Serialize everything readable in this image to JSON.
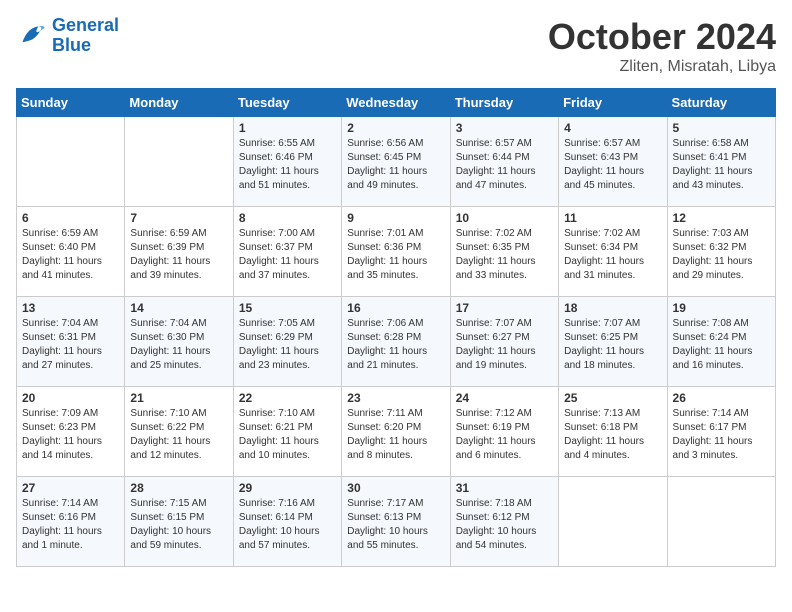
{
  "logo": {
    "line1": "General",
    "line2": "Blue"
  },
  "title": "October 2024",
  "subtitle": "Zliten, Misratah, Libya",
  "weekdays": [
    "Sunday",
    "Monday",
    "Tuesday",
    "Wednesday",
    "Thursday",
    "Friday",
    "Saturday"
  ],
  "weeks": [
    [
      {
        "day": "",
        "info": ""
      },
      {
        "day": "",
        "info": ""
      },
      {
        "day": "1",
        "info": "Sunrise: 6:55 AM\nSunset: 6:46 PM\nDaylight: 11 hours and 51 minutes."
      },
      {
        "day": "2",
        "info": "Sunrise: 6:56 AM\nSunset: 6:45 PM\nDaylight: 11 hours and 49 minutes."
      },
      {
        "day": "3",
        "info": "Sunrise: 6:57 AM\nSunset: 6:44 PM\nDaylight: 11 hours and 47 minutes."
      },
      {
        "day": "4",
        "info": "Sunrise: 6:57 AM\nSunset: 6:43 PM\nDaylight: 11 hours and 45 minutes."
      },
      {
        "day": "5",
        "info": "Sunrise: 6:58 AM\nSunset: 6:41 PM\nDaylight: 11 hours and 43 minutes."
      }
    ],
    [
      {
        "day": "6",
        "info": "Sunrise: 6:59 AM\nSunset: 6:40 PM\nDaylight: 11 hours and 41 minutes."
      },
      {
        "day": "7",
        "info": "Sunrise: 6:59 AM\nSunset: 6:39 PM\nDaylight: 11 hours and 39 minutes."
      },
      {
        "day": "8",
        "info": "Sunrise: 7:00 AM\nSunset: 6:37 PM\nDaylight: 11 hours and 37 minutes."
      },
      {
        "day": "9",
        "info": "Sunrise: 7:01 AM\nSunset: 6:36 PM\nDaylight: 11 hours and 35 minutes."
      },
      {
        "day": "10",
        "info": "Sunrise: 7:02 AM\nSunset: 6:35 PM\nDaylight: 11 hours and 33 minutes."
      },
      {
        "day": "11",
        "info": "Sunrise: 7:02 AM\nSunset: 6:34 PM\nDaylight: 11 hours and 31 minutes."
      },
      {
        "day": "12",
        "info": "Sunrise: 7:03 AM\nSunset: 6:32 PM\nDaylight: 11 hours and 29 minutes."
      }
    ],
    [
      {
        "day": "13",
        "info": "Sunrise: 7:04 AM\nSunset: 6:31 PM\nDaylight: 11 hours and 27 minutes."
      },
      {
        "day": "14",
        "info": "Sunrise: 7:04 AM\nSunset: 6:30 PM\nDaylight: 11 hours and 25 minutes."
      },
      {
        "day": "15",
        "info": "Sunrise: 7:05 AM\nSunset: 6:29 PM\nDaylight: 11 hours and 23 minutes."
      },
      {
        "day": "16",
        "info": "Sunrise: 7:06 AM\nSunset: 6:28 PM\nDaylight: 11 hours and 21 minutes."
      },
      {
        "day": "17",
        "info": "Sunrise: 7:07 AM\nSunset: 6:27 PM\nDaylight: 11 hours and 19 minutes."
      },
      {
        "day": "18",
        "info": "Sunrise: 7:07 AM\nSunset: 6:25 PM\nDaylight: 11 hours and 18 minutes."
      },
      {
        "day": "19",
        "info": "Sunrise: 7:08 AM\nSunset: 6:24 PM\nDaylight: 11 hours and 16 minutes."
      }
    ],
    [
      {
        "day": "20",
        "info": "Sunrise: 7:09 AM\nSunset: 6:23 PM\nDaylight: 11 hours and 14 minutes."
      },
      {
        "day": "21",
        "info": "Sunrise: 7:10 AM\nSunset: 6:22 PM\nDaylight: 11 hours and 12 minutes."
      },
      {
        "day": "22",
        "info": "Sunrise: 7:10 AM\nSunset: 6:21 PM\nDaylight: 11 hours and 10 minutes."
      },
      {
        "day": "23",
        "info": "Sunrise: 7:11 AM\nSunset: 6:20 PM\nDaylight: 11 hours and 8 minutes."
      },
      {
        "day": "24",
        "info": "Sunrise: 7:12 AM\nSunset: 6:19 PM\nDaylight: 11 hours and 6 minutes."
      },
      {
        "day": "25",
        "info": "Sunrise: 7:13 AM\nSunset: 6:18 PM\nDaylight: 11 hours and 4 minutes."
      },
      {
        "day": "26",
        "info": "Sunrise: 7:14 AM\nSunset: 6:17 PM\nDaylight: 11 hours and 3 minutes."
      }
    ],
    [
      {
        "day": "27",
        "info": "Sunrise: 7:14 AM\nSunset: 6:16 PM\nDaylight: 11 hours and 1 minute."
      },
      {
        "day": "28",
        "info": "Sunrise: 7:15 AM\nSunset: 6:15 PM\nDaylight: 10 hours and 59 minutes."
      },
      {
        "day": "29",
        "info": "Sunrise: 7:16 AM\nSunset: 6:14 PM\nDaylight: 10 hours and 57 minutes."
      },
      {
        "day": "30",
        "info": "Sunrise: 7:17 AM\nSunset: 6:13 PM\nDaylight: 10 hours and 55 minutes."
      },
      {
        "day": "31",
        "info": "Sunrise: 7:18 AM\nSunset: 6:12 PM\nDaylight: 10 hours and 54 minutes."
      },
      {
        "day": "",
        "info": ""
      },
      {
        "day": "",
        "info": ""
      }
    ]
  ]
}
